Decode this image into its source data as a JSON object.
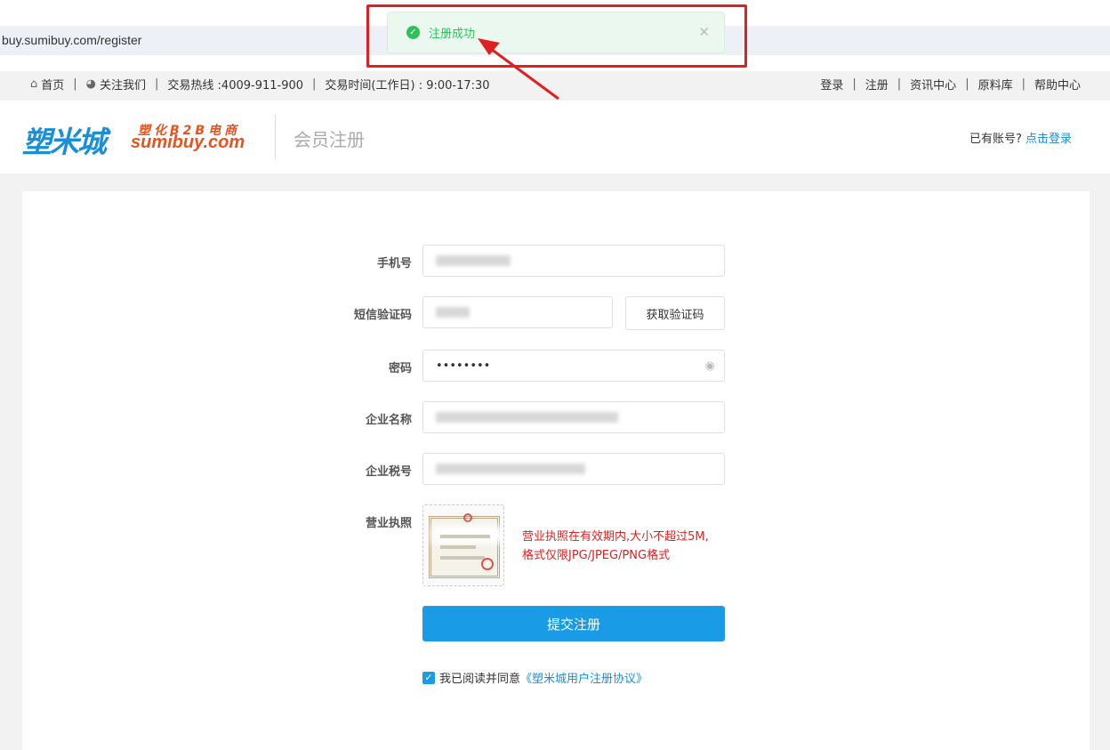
{
  "browser": {
    "url": "buy.sumibuy.com/register"
  },
  "toast": {
    "message": "注册成功"
  },
  "topnav": {
    "home": "首页",
    "follow": "关注我们",
    "hotline": "交易热线 :4009-911-900",
    "hours": "交易时间(工作日) : 9:00-17:30",
    "links": [
      "登录",
      "注册",
      "资讯中心",
      "原料库",
      "帮助中心"
    ]
  },
  "header": {
    "logo_cn": "塑米城",
    "logo_sub": "塑化B2B电商",
    "logo_en": "sumibuy.com",
    "page_title": "会员注册",
    "have_account": "已有账号?",
    "login_link": "点击登录"
  },
  "form": {
    "phone_label": "手机号",
    "sms_label": "短信验证码",
    "get_code": "获取验证码",
    "password_label": "密码",
    "password_value": "••••••••",
    "company_label": "企业名称",
    "taxid_label": "企业税号",
    "license_label": "营业执照",
    "license_hint_1": "营业执照在有效期内,大小不超过5M,",
    "license_hint_2": "格式仅限JPG/JPEG/PNG格式",
    "submit": "提交注册",
    "agree_text": "我已阅读并同意",
    "agree_link": "《塑米城用户注册协议》"
  },
  "colors": {
    "accent": "#1a9be6",
    "brand_orange": "#e8531d",
    "success": "#2ec15a",
    "annotation": "#e02020"
  }
}
